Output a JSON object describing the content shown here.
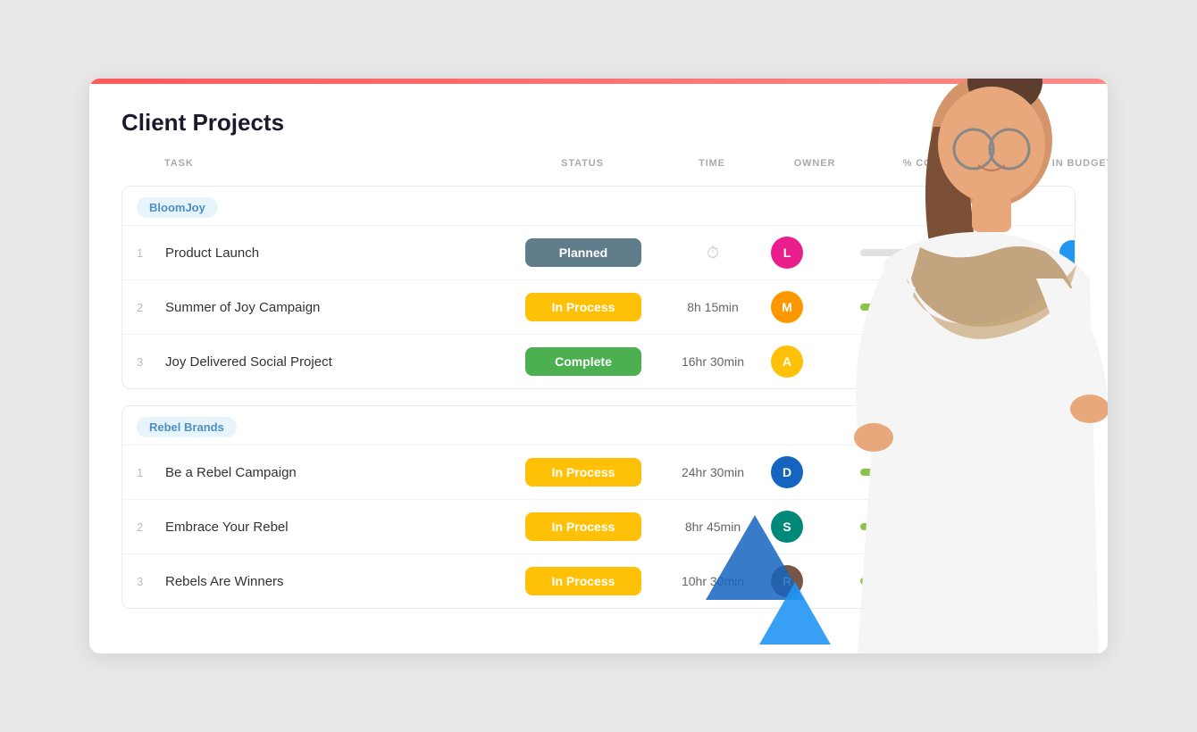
{
  "page": {
    "title": "Client Projects",
    "bg_color": "#e8e8e8"
  },
  "table": {
    "columns": [
      {
        "label": "TASK",
        "key": "task"
      },
      {
        "label": "STATUS",
        "key": "status"
      },
      {
        "label": "TIME",
        "key": "time"
      },
      {
        "label": "OWNER",
        "key": "owner"
      },
      {
        "label": "% COMPLETE",
        "key": "complete"
      },
      {
        "label": "IN BUDGET",
        "key": "budget"
      }
    ],
    "add_label": "+"
  },
  "groups": [
    {
      "id": "bloomjoy",
      "label": "BloomJoy",
      "tasks": [
        {
          "num": "1",
          "name": "Product Launch",
          "status": "Planned",
          "status_class": "status-planned",
          "time": "",
          "time_icon": true,
          "owner_initials": "L",
          "owner_color": "av-pink",
          "progress": "fill-none",
          "budget_on": true
        },
        {
          "num": "2",
          "name": "Summer of Joy Campaign",
          "status": "In Process",
          "status_class": "status-inprocess",
          "time": "8h 15min",
          "time_icon": false,
          "owner_initials": "M",
          "owner_color": "av-orange",
          "progress": "fill-low",
          "budget_on": true
        },
        {
          "num": "3",
          "name": "Joy Delivered Social Project",
          "status": "Complete",
          "status_class": "status-complete",
          "time": "16hr 30min",
          "time_icon": false,
          "owner_initials": "A",
          "owner_color": "av-yellow",
          "progress": "fill-high",
          "budget_on": false
        }
      ]
    },
    {
      "id": "rebel-brands",
      "label": "Rebel Brands",
      "tasks": [
        {
          "num": "1",
          "name": "Be a Rebel Campaign",
          "status": "In Process",
          "status_class": "status-inprocess",
          "time": "24hr 30min",
          "time_icon": false,
          "owner_initials": "D",
          "owner_color": "av-blue",
          "progress": "fill-low",
          "budget_on": true
        },
        {
          "num": "2",
          "name": "Embrace Your Rebel",
          "status": "In Process",
          "status_class": "status-inprocess",
          "time": "8hr 45min",
          "time_icon": false,
          "owner_initials": "S",
          "owner_color": "av-teal",
          "progress": "fill-med",
          "budget_on": true
        },
        {
          "num": "3",
          "name": "Rebels Are Winners",
          "status": "In Process",
          "status_class": "status-inprocess",
          "time": "10hr 30min",
          "time_icon": false,
          "owner_initials": "R",
          "owner_color": "av-brown",
          "progress": "fill-med2",
          "budget_on": true
        }
      ]
    }
  ],
  "complete_badge": {
    "label": "COMPLETE",
    "color": "#4caf50"
  }
}
